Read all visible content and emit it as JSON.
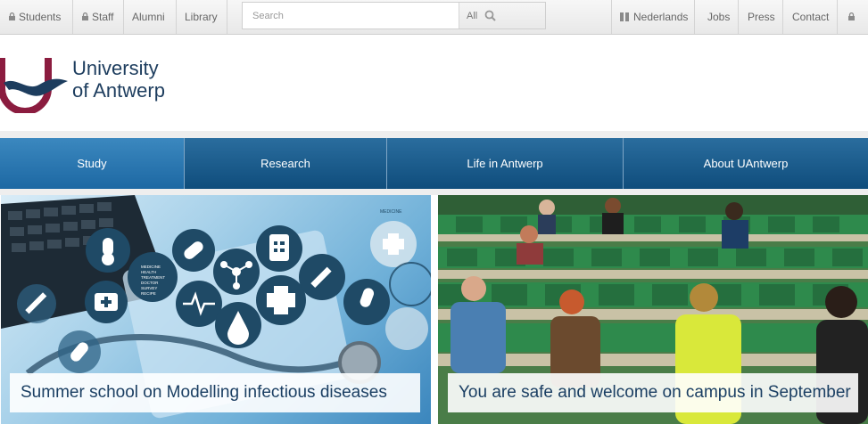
{
  "topbar": {
    "left_items": [
      {
        "label": "Students",
        "icon": "lock-icon"
      },
      {
        "label": "Staff",
        "icon": "lock-icon"
      },
      {
        "label": "Alumni"
      },
      {
        "label": "Library"
      }
    ],
    "search": {
      "placeholder": "Search",
      "filter_value": "All",
      "icon": "search-icon"
    },
    "right_items": [
      {
        "label": "Nederlands",
        "icon": "flag-icon"
      },
      {
        "label": "Jobs"
      },
      {
        "label": "Press"
      },
      {
        "label": "Contact"
      },
      {
        "icon": "lock-icon"
      }
    ]
  },
  "logo": {
    "line1": "University",
    "line2": "of Antwerp",
    "colors": {
      "maroon": "#8b1c3f",
      "navy": "#1d3d5e"
    }
  },
  "main_nav": {
    "items": [
      {
        "label": "Study",
        "active": true
      },
      {
        "label": "Research"
      },
      {
        "label": "Life in Antwerp"
      },
      {
        "label": "About UAntwerp"
      }
    ],
    "colors": {
      "bar": "#0f4d7c",
      "active": "#2a78b3"
    }
  },
  "tiles": [
    {
      "caption": "Summer school on Modelling infectious diseases",
      "icon_labels": [
        "MEDICINE",
        "HEALTH",
        "TREATMENT",
        "DOCTOR",
        "SURVEY",
        "RECIPE"
      ]
    },
    {
      "caption": "You are safe and welcome on campus in September"
    }
  ]
}
